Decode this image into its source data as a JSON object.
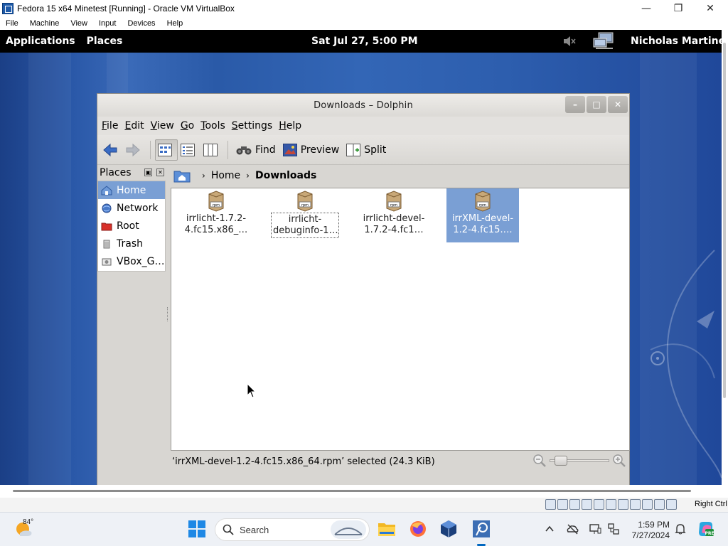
{
  "host": {
    "title": "Fedora 15 x64 Minetest [Running] - Oracle VM VirtualBox",
    "menu": [
      "File",
      "Machine",
      "View",
      "Input",
      "Devices",
      "Help"
    ],
    "status_right": "Right Ctrl"
  },
  "gnome_panel": {
    "applications": "Applications",
    "places": "Places",
    "clock": "Sat Jul 27,  5:00 PM",
    "user": "Nicholas Martine"
  },
  "dolphin": {
    "title": "Downloads – Dolphin",
    "menu": [
      "File",
      "Edit",
      "View",
      "Go",
      "Tools",
      "Settings",
      "Help"
    ],
    "toolbar": {
      "find": "Find",
      "preview": "Preview",
      "split": "Split"
    },
    "places": {
      "header": "Places",
      "items": [
        {
          "label": "Home",
          "icon": "home-icon",
          "selected": true
        },
        {
          "label": "Network",
          "icon": "network-icon",
          "selected": false
        },
        {
          "label": "Root",
          "icon": "root-folder-icon",
          "selected": false
        },
        {
          "label": "Trash",
          "icon": "trash-icon",
          "selected": false
        },
        {
          "label": "VBox_G…",
          "icon": "drive-icon",
          "selected": false
        }
      ]
    },
    "breadcrumb": {
      "home": "Home",
      "current": "Downloads"
    },
    "files": [
      {
        "name": "irrlicht-1.7.2-\n4.fc15.x86_…",
        "icon": "rpm-package-icon"
      },
      {
        "name": "irrlicht-\ndebuginfo-1…",
        "icon": "rpm-package-icon"
      },
      {
        "name": "irrlicht-devel-\n1.7.2-4.fc1…",
        "icon": "rpm-package-icon"
      },
      {
        "name": "irrXML-devel-\n1.2-4.fc15.…",
        "icon": "rpm-package-icon"
      }
    ],
    "status": "‘irrXML-devel-1.2-4.fc15.x86_64.rpm’ selected (24.3 KiB)"
  },
  "taskbar": {
    "temperature": "84°",
    "search_placeholder": "Search",
    "time": "1:59 PM",
    "date": "7/27/2024"
  }
}
